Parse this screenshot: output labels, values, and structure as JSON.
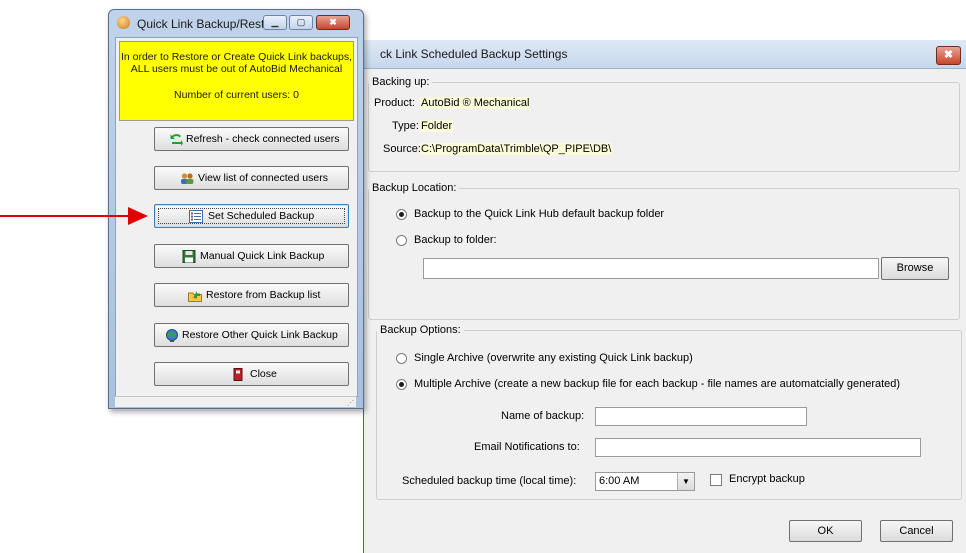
{
  "settings_window": {
    "title": "ck Link Scheduled Backup Settings",
    "close_glyph": "✖",
    "backing_up": {
      "legend": "Backing up:",
      "product_label": "Product:",
      "product_value": "AutoBid ® Mechanical",
      "type_label": "Type:",
      "type_value": "Folder",
      "source_label": "Source:",
      "source_value": "C:\\ProgramData\\Trimble\\QP_PIPE\\DB\\"
    },
    "location": {
      "legend": "Backup Location:",
      "option_default": "Backup to the Quick Link Hub default backup folder",
      "option_folder": "Backup to folder:",
      "folder_value": "",
      "browse_label": "Browse"
    },
    "options": {
      "legend": "Backup Options:",
      "single_archive": "Single Archive (overwrite any existing Quick Link backup)",
      "multiple_archive": "Multiple Archive (create a new backup file for each backup - file names are automatcially generated)",
      "name_label": "Name of backup:",
      "name_value": "",
      "email_label": "Email Notifications to:",
      "email_value": "",
      "time_label": "Scheduled backup time (local time):",
      "time_value": "6:00 AM",
      "encrypt_label": "Encrypt backup"
    },
    "ok_label": "OK",
    "cancel_label": "Cancel"
  },
  "quicklink_window": {
    "title": "Quick Link Backup/Restore",
    "banner_line1": "In order to Restore or Create Quick Link backups,",
    "banner_line2": "ALL users must be out of AutoBid Mechanical",
    "banner_line3": "Number of current users: 0",
    "buttons": [
      {
        "label": "Refresh - check connected users",
        "icon": "refresh-arrow-icon"
      },
      {
        "label": "View list of connected users",
        "icon": "users-icon"
      },
      {
        "label": "Set Scheduled Backup",
        "icon": "schedule-list-icon"
      },
      {
        "label": "Manual Quick Link Backup",
        "icon": "floppy-disk-icon"
      },
      {
        "label": "Restore from Backup list",
        "icon": "folder-restore-icon"
      },
      {
        "label": "Restore Other Quick Link Backup",
        "icon": "globe-icon"
      },
      {
        "label": "Close",
        "icon": "exit-door-icon"
      }
    ]
  },
  "colors": {
    "banner": "#ffff00",
    "annotation_arrow": "#e00000",
    "value_highlight": "#fbfbd8"
  }
}
